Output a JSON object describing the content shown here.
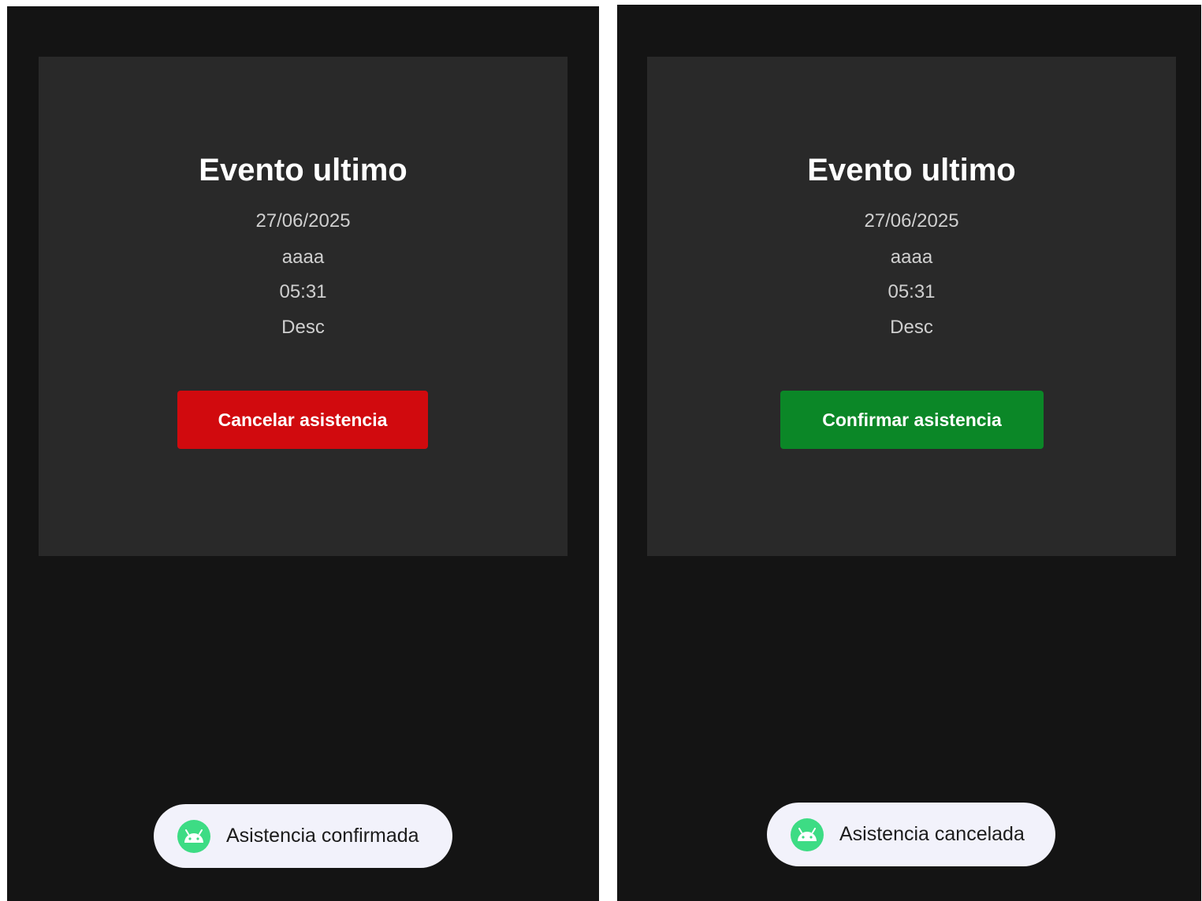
{
  "colors": {
    "screen_background": "#141414",
    "card_background": "#292929",
    "cancel_button": "#d10a0e",
    "confirm_button": "#0b8727",
    "toast_background": "#f2f2fb",
    "android_green": "#3ddc84"
  },
  "left": {
    "event": {
      "title": "Evento ultimo",
      "date": "27/06/2025",
      "place": "aaaa",
      "time": "05:31",
      "description": "Desc"
    },
    "action_button": {
      "label": "Cancelar asistencia"
    },
    "toast": {
      "icon": "android-icon",
      "message": "Asistencia confirmada"
    }
  },
  "right": {
    "event": {
      "title": "Evento ultimo",
      "date": "27/06/2025",
      "place": "aaaa",
      "time": "05:31",
      "description": "Desc"
    },
    "action_button": {
      "label": "Confirmar asistencia"
    },
    "toast": {
      "icon": "android-icon",
      "message": "Asistencia cancelada"
    }
  }
}
